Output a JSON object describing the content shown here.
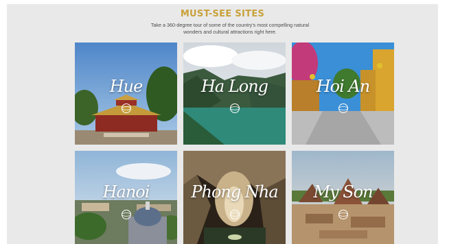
{
  "header": {
    "title": "MUST-SEE SITES",
    "subtitle_line1": "Take a 360-degree tour of some of the country's most compelling natural",
    "subtitle_line2": "wonders and cultural attractions right here."
  },
  "colors": {
    "title": "#c8a13a",
    "background": "#e9e9e9"
  },
  "sites": [
    {
      "name": "Hue",
      "icon": "360-view-icon"
    },
    {
      "name": "Ha Long",
      "icon": "360-view-icon"
    },
    {
      "name": "Hoi An",
      "icon": "360-view-icon"
    },
    {
      "name": "Hanoi",
      "icon": "360-view-icon"
    },
    {
      "name": "Phong Nha",
      "icon": "360-view-icon"
    },
    {
      "name": "My Son",
      "icon": "360-view-icon"
    }
  ]
}
